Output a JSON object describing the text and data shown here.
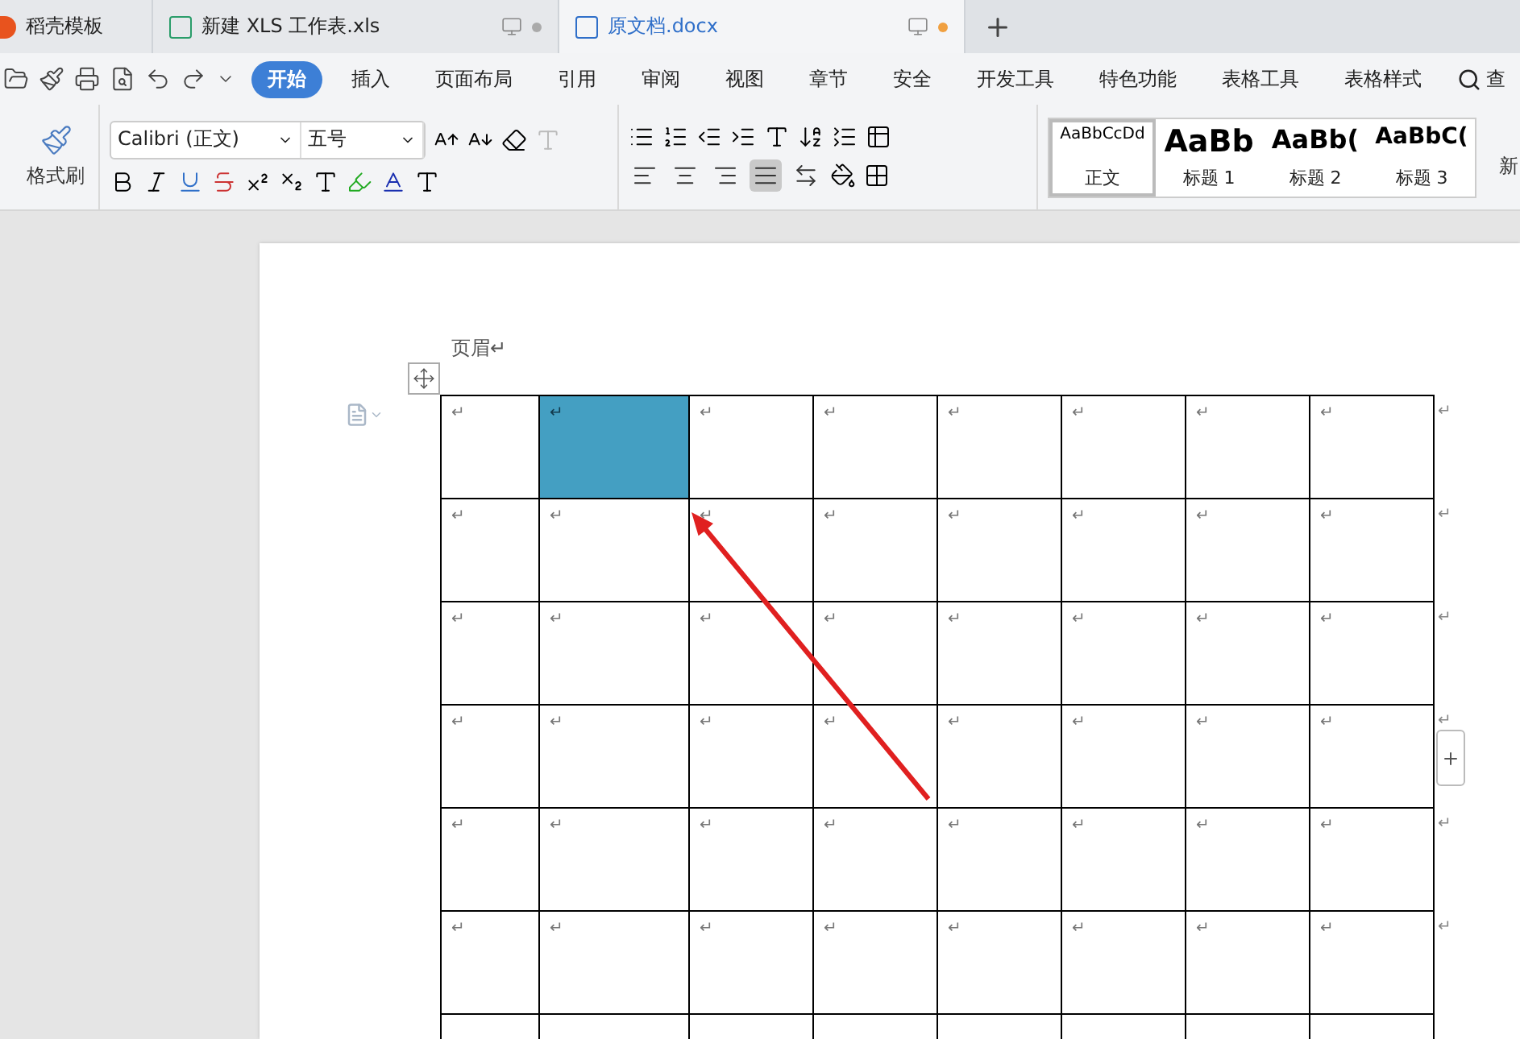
{
  "tabs": [
    {
      "kind": "template",
      "label": "稻壳模板",
      "selected": false
    },
    {
      "kind": "sheet",
      "label": "新建 XLS 工作表.xls",
      "selected": false,
      "unsaved": false
    },
    {
      "kind": "doc",
      "label": "原文档.docx",
      "selected": true,
      "unsaved": true
    }
  ],
  "menu": [
    {
      "label": "开始",
      "selected": true
    },
    {
      "label": "插入",
      "selected": false
    },
    {
      "label": "页面布局",
      "selected": false
    },
    {
      "label": "引用",
      "selected": false
    },
    {
      "label": "审阅",
      "selected": false
    },
    {
      "label": "视图",
      "selected": false
    },
    {
      "label": "章节",
      "selected": false
    },
    {
      "label": "安全",
      "selected": false
    },
    {
      "label": "开发工具",
      "selected": false
    },
    {
      "label": "特色功能",
      "selected": false
    },
    {
      "label": "表格工具",
      "selected": false
    },
    {
      "label": "表格样式",
      "selected": false
    }
  ],
  "search_label": "查",
  "format_painter": "格式刷",
  "font": {
    "name": "Calibri (正文)",
    "size": "五号"
  },
  "alignment": [
    {
      "kind": "left",
      "selected": false
    },
    {
      "kind": "center",
      "selected": false
    },
    {
      "kind": "right",
      "selected": false
    },
    {
      "kind": "justify",
      "selected": true
    },
    {
      "kind": "distributed",
      "selected": false
    }
  ],
  "styles": [
    {
      "preview": "AaBbCcDd",
      "label": "正文",
      "kind": "body",
      "selected": true
    },
    {
      "preview": "AaBb",
      "label": "标题 1",
      "kind": "h1",
      "selected": false
    },
    {
      "preview": "AaBb(",
      "label": "标题 2",
      "kind": "h2",
      "selected": false
    },
    {
      "preview": "AaBbC(",
      "label": "标题 3",
      "kind": "h3",
      "selected": false
    }
  ],
  "new_style_label": "新",
  "document": {
    "header": "页眉↵",
    "table": {
      "rows": [
        {
          "end_mark": "↵",
          "cells": [
            {
              "text": "↵",
              "selected": false
            },
            {
              "text": "↵",
              "selected": true
            },
            {
              "text": "↵",
              "selected": false
            },
            {
              "text": "↵",
              "selected": false
            },
            {
              "text": "↵",
              "selected": false
            },
            {
              "text": "↵",
              "selected": false
            },
            {
              "text": "↵",
              "selected": false
            },
            {
              "text": "↵",
              "selected": false
            }
          ]
        },
        {
          "end_mark": "↵",
          "cells": [
            {
              "text": "↵",
              "selected": false
            },
            {
              "text": "↵",
              "selected": false
            },
            {
              "text": "↵",
              "selected": false
            },
            {
              "text": "↵",
              "selected": false
            },
            {
              "text": "↵",
              "selected": false
            },
            {
              "text": "↵",
              "selected": false
            },
            {
              "text": "↵",
              "selected": false
            },
            {
              "text": "↵",
              "selected": false
            }
          ]
        },
        {
          "end_mark": "↵",
          "cells": [
            {
              "text": "↵",
              "selected": false
            },
            {
              "text": "↵",
              "selected": false
            },
            {
              "text": "↵",
              "selected": false
            },
            {
              "text": "↵",
              "selected": false
            },
            {
              "text": "↵",
              "selected": false
            },
            {
              "text": "↵",
              "selected": false
            },
            {
              "text": "↵",
              "selected": false
            },
            {
              "text": "↵",
              "selected": false
            }
          ]
        },
        {
          "end_mark": "↵",
          "cells": [
            {
              "text": "↵",
              "selected": false
            },
            {
              "text": "↵",
              "selected": false
            },
            {
              "text": "↵",
              "selected": false
            },
            {
              "text": "↵",
              "selected": false
            },
            {
              "text": "↵",
              "selected": false
            },
            {
              "text": "↵",
              "selected": false
            },
            {
              "text": "↵",
              "selected": false
            },
            {
              "text": "↵",
              "selected": false
            }
          ]
        },
        {
          "end_mark": "↵",
          "cells": [
            {
              "text": "↵",
              "selected": false
            },
            {
              "text": "↵",
              "selected": false
            },
            {
              "text": "↵",
              "selected": false
            },
            {
              "text": "↵",
              "selected": false
            },
            {
              "text": "↵",
              "selected": false
            },
            {
              "text": "↵",
              "selected": false
            },
            {
              "text": "↵",
              "selected": false
            },
            {
              "text": "↵",
              "selected": false
            }
          ]
        },
        {
          "end_mark": "↵",
          "cells": [
            {
              "text": "↵",
              "selected": false
            },
            {
              "text": "↵",
              "selected": false
            },
            {
              "text": "↵",
              "selected": false
            },
            {
              "text": "↵",
              "selected": false
            },
            {
              "text": "↵",
              "selected": false
            },
            {
              "text": "↵",
              "selected": false
            },
            {
              "text": "↵",
              "selected": false
            },
            {
              "text": "↵",
              "selected": false
            }
          ]
        },
        {
          "end_mark": "",
          "cells": [
            {
              "text": "",
              "selected": false
            },
            {
              "text": "",
              "selected": false
            },
            {
              "text": "",
              "selected": false
            },
            {
              "text": "",
              "selected": false
            },
            {
              "text": "",
              "selected": false
            },
            {
              "text": "",
              "selected": false
            },
            {
              "text": "",
              "selected": false
            },
            {
              "text": "",
              "selected": false
            }
          ]
        }
      ]
    }
  }
}
